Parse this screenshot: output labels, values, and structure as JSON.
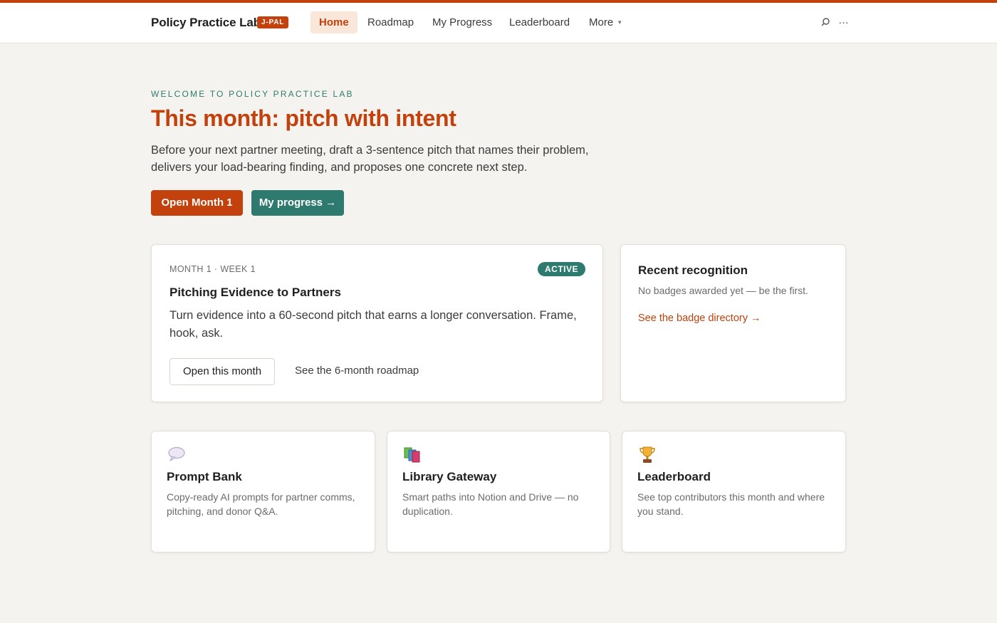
{
  "nav": {
    "brand": "Policy Practice Lab",
    "badge": "J-PAL",
    "links": [
      "Home",
      "Roadmap",
      "My Progress",
      "Leaderboard",
      "More"
    ],
    "active": "Home",
    "search_icon": "search-icon",
    "more_icon": "ellipsis-icon"
  },
  "hero": {
    "eyebrow": "WELCOME TO POLICY PRACTICE LAB",
    "title": "This month: pitch with intent",
    "text": "Before your next partner meeting, draft a 3-sentence pitch that names their problem, delivers your load-bearing finding, and proposes one concrete next step.",
    "primary_button": "Open Month 1",
    "secondary_button": "My progress →"
  },
  "month_card": {
    "meta": "MONTH 1 · WEEK 1",
    "status": "ACTIVE",
    "title": "Pitching Evidence to Partners",
    "description": "Turn evidence into a 60-second pitch that earns a longer conversation. Frame, hook, ask.",
    "open_button": "Open this month",
    "roadmap_link": "See the 6-month roadmap"
  },
  "recognition": {
    "title": "Recent recognition",
    "empty_text": "No badges awarded yet — be the first.",
    "link": "See the badge directory →"
  },
  "tiles": [
    {
      "icon": "speech-bubble-icon",
      "title": "Prompt Bank",
      "description": "Copy-ready AI prompts for partner comms, pitching, and donor Q&A."
    },
    {
      "icon": "books-icon",
      "title": "Library Gateway",
      "description": "Smart paths into Notion and Drive — no duplication."
    },
    {
      "icon": "trophy-icon",
      "title": "Leaderboard",
      "description": "See top contributors this month and where you stand."
    }
  ],
  "colors": {
    "accent": "#c2410c",
    "teal": "#2f7a6f",
    "background": "#f5f3ef"
  }
}
